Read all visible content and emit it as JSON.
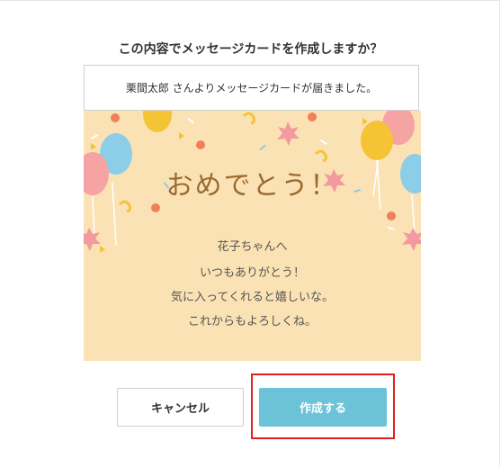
{
  "dialog": {
    "title": "この内容でメッセージカードを作成しますか？",
    "sender_line": "栗間太郎 さんよりメッセージカードが届きました。"
  },
  "card": {
    "heading": "おめでとう！",
    "recipient": "花子ちゃんへ",
    "lines": [
      "いつもありがとう！",
      "気に入ってくれると嬉しいな。",
      "これからもよろしくね。"
    ],
    "background_color": "#fbe2b4"
  },
  "buttons": {
    "cancel_label": "キャンセル",
    "create_label": "作成する",
    "create_color": "#6cc3d8"
  },
  "annotation": {
    "highlight_color": "#e02020"
  }
}
